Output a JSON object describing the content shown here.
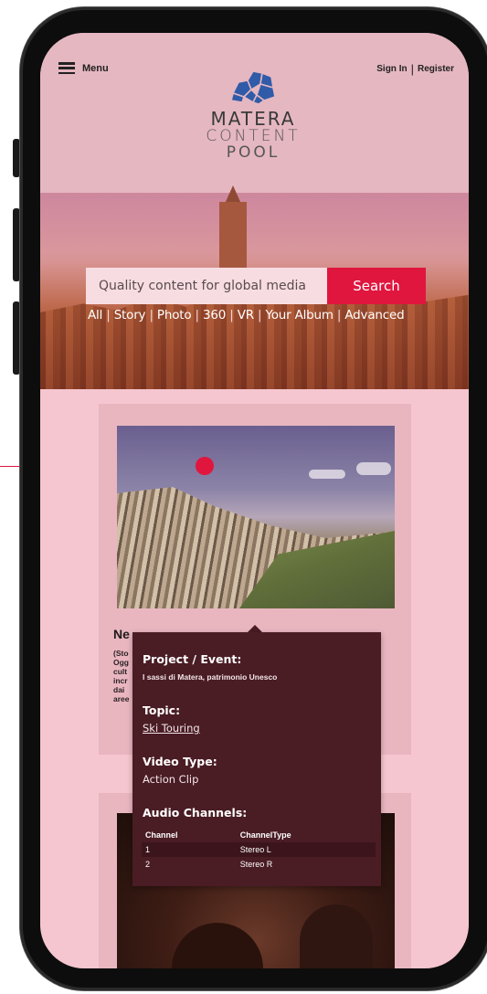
{
  "header": {
    "menu_label": "Menu",
    "sign_in": "Sign In",
    "separator": "|",
    "register": "Register",
    "logo_line1": "MATERA",
    "logo_line2": "CONTENT",
    "logo_line3": "POOL",
    "brand_color": "#2f5ba8"
  },
  "search": {
    "placeholder": "Quality content for global media",
    "button_label": "Search",
    "accent_color": "#e0163f"
  },
  "filters": {
    "items": [
      "All",
      "Story",
      "Photo",
      "360",
      "VR",
      "Your Album",
      "Advanced"
    ],
    "separator": "|"
  },
  "card1": {
    "title_visible": "Ne",
    "body_visible": "(Sto\nOgg\ncult\nincr\ndai\naree"
  },
  "tooltip": {
    "project_label": "Project / Event:",
    "project_value": "I sassi di Matera, patrimonio Unesco",
    "topic_label": "Topic:",
    "topic_value": "Ski Touring",
    "video_type_label": "Video Type:",
    "video_type_value": "Action Clip",
    "audio_label": "Audio Channels:",
    "audio_table": {
      "headers": [
        "Channel",
        "ChannelType"
      ],
      "rows": [
        [
          "1",
          "Stereo L"
        ],
        [
          "2",
          "Stereo R"
        ]
      ]
    }
  }
}
